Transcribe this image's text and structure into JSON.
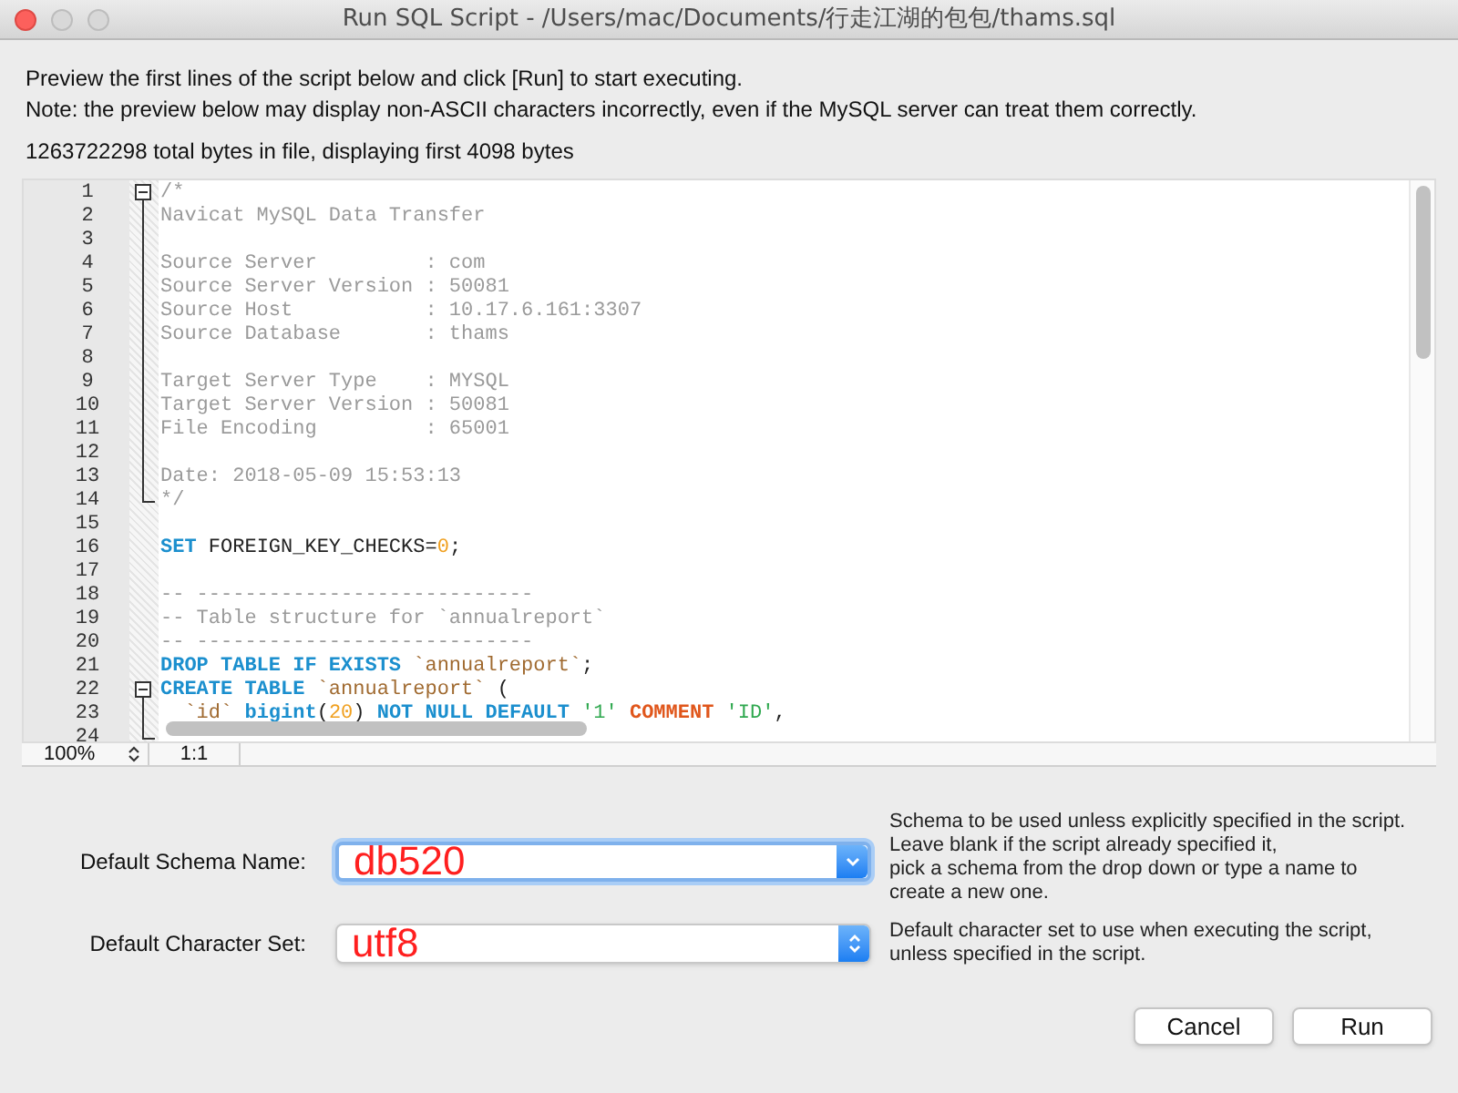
{
  "window": {
    "title": "Run SQL Script - /Users/mac/Documents/行走江湖的包包/thams.sql"
  },
  "intro": [
    "Preview the first lines of the script below and click [Run] to start executing.",
    "Note: the preview below may display non-ASCII characters incorrectly, even if the MySQL server can treat them correctly."
  ],
  "file_info": "1263722298 total bytes in file, displaying first 4098 bytes",
  "editor": {
    "lines": [
      {
        "number": "1",
        "fold_toggle": true,
        "fold_guide": false,
        "fold_end": false,
        "tokens": [
          {
            "kind": "comment",
            "text": "/*"
          }
        ]
      },
      {
        "number": "2",
        "fold_toggle": false,
        "fold_guide": true,
        "fold_end": false,
        "tokens": [
          {
            "kind": "comment",
            "text": "Navicat MySQL Data Transfer"
          }
        ]
      },
      {
        "number": "3",
        "fold_toggle": false,
        "fold_guide": true,
        "fold_end": false
      },
      {
        "number": "4",
        "fold_toggle": false,
        "fold_guide": true,
        "fold_end": false,
        "tokens": [
          {
            "kind": "comment",
            "text": "Source Server         : com"
          }
        ]
      },
      {
        "number": "5",
        "fold_toggle": false,
        "fold_guide": true,
        "fold_end": false,
        "tokens": [
          {
            "kind": "comment",
            "text": "Source Server Version : 50081"
          }
        ]
      },
      {
        "number": "6",
        "fold_toggle": false,
        "fold_guide": true,
        "fold_end": false,
        "tokens": [
          {
            "kind": "comment",
            "text": "Source Host           : 10.17.6.161:3307"
          }
        ]
      },
      {
        "number": "7",
        "fold_toggle": false,
        "fold_guide": true,
        "fold_end": false,
        "tokens": [
          {
            "kind": "comment",
            "text": "Source Database       : thams"
          }
        ]
      },
      {
        "number": "8",
        "fold_toggle": false,
        "fold_guide": true,
        "fold_end": false
      },
      {
        "number": "9",
        "fold_toggle": false,
        "fold_guide": true,
        "fold_end": false,
        "tokens": [
          {
            "kind": "comment",
            "text": "Target Server Type    : MYSQL"
          }
        ]
      },
      {
        "number": "10",
        "fold_toggle": false,
        "fold_guide": true,
        "fold_end": false,
        "tokens": [
          {
            "kind": "comment",
            "text": "Target Server Version : 50081"
          }
        ]
      },
      {
        "number": "11",
        "fold_toggle": false,
        "fold_guide": true,
        "fold_end": false,
        "tokens": [
          {
            "kind": "comment",
            "text": "File Encoding         : 65001"
          }
        ]
      },
      {
        "number": "12",
        "fold_toggle": false,
        "fold_guide": true,
        "fold_end": false
      },
      {
        "number": "13",
        "fold_toggle": false,
        "fold_guide": true,
        "fold_end": false,
        "tokens": [
          {
            "kind": "comment",
            "text": "Date: 2018-05-09 15:53:13"
          }
        ]
      },
      {
        "number": "14",
        "fold_toggle": false,
        "fold_guide": false,
        "fold_end": true,
        "tokens": [
          {
            "kind": "comment",
            "text": "*/"
          }
        ]
      },
      {
        "number": "15",
        "fold_toggle": false,
        "fold_guide": false,
        "fold_end": false
      },
      {
        "number": "16",
        "fold_toggle": false,
        "fold_guide": false,
        "fold_end": false,
        "tokens": [
          {
            "kind": "keyword",
            "text": "SET"
          },
          {
            "kind": "plain",
            "text": " FOREIGN_KEY_CHECKS="
          },
          {
            "kind": "number",
            "text": "0"
          },
          {
            "kind": "plain",
            "text": ";"
          }
        ]
      },
      {
        "number": "17",
        "fold_toggle": false,
        "fold_guide": false,
        "fold_end": false
      },
      {
        "number": "18",
        "fold_toggle": false,
        "fold_guide": false,
        "fold_end": false,
        "tokens": [
          {
            "kind": "comment",
            "text": "-- ----------------------------"
          }
        ]
      },
      {
        "number": "19",
        "fold_toggle": false,
        "fold_guide": false,
        "fold_end": false,
        "tokens": [
          {
            "kind": "comment",
            "text": "-- Table structure for `annualreport`"
          }
        ]
      },
      {
        "number": "20",
        "fold_toggle": false,
        "fold_guide": false,
        "fold_end": false,
        "tokens": [
          {
            "kind": "comment",
            "text": "-- ----------------------------"
          }
        ]
      },
      {
        "number": "21",
        "fold_toggle": false,
        "fold_guide": false,
        "fold_end": false,
        "tokens": [
          {
            "kind": "keyword",
            "text": "DROP TABLE IF EXISTS "
          },
          {
            "kind": "identifier",
            "text": "`annualreport`"
          },
          {
            "kind": "plain",
            "text": ";"
          }
        ]
      },
      {
        "number": "22",
        "fold_toggle": true,
        "fold_guide": false,
        "fold_end": false,
        "tokens": [
          {
            "kind": "keyword",
            "text": "CREATE TABLE "
          },
          {
            "kind": "identifier",
            "text": "`annualreport`"
          },
          {
            "kind": "plain",
            "text": " ("
          }
        ]
      },
      {
        "number": "23",
        "fold_toggle": false,
        "fold_guide": true,
        "fold_end": false,
        "tokens": [
          {
            "kind": "identifier",
            "text": "  `id` "
          },
          {
            "kind": "keyword",
            "text": "bigint"
          },
          {
            "kind": "plain",
            "text": "("
          },
          {
            "kind": "number",
            "text": "20"
          },
          {
            "kind": "plain",
            "text": ") "
          },
          {
            "kind": "keyword",
            "text": "NOT NULL DEFAULT "
          },
          {
            "kind": "string",
            "text": "'1' "
          },
          {
            "kind": "attribute",
            "text": "COMMENT "
          },
          {
            "kind": "string",
            "text": "'ID'"
          },
          {
            "kind": "plain",
            "text": ","
          }
        ]
      },
      {
        "number": "24",
        "fold_toggle": false,
        "fold_guide": false,
        "fold_end": true
      }
    ],
    "zoom": "100%",
    "position": "1:1"
  },
  "fields": [
    {
      "label": "Default Schema Name:",
      "value": "db520",
      "kind": "combobox",
      "focused": true,
      "help": "Schema to be used unless explicitly specified in the script.\nLeave blank if the script already specified it,\npick a schema from the drop down or type a name to\ncreate a new one."
    },
    {
      "label": "Default Character Set:",
      "value": "utf8",
      "kind": "popup",
      "focused": false,
      "help": "Default character set to use when executing the script,\nunless specified in the script."
    }
  ],
  "buttons": [
    "Cancel",
    "Run"
  ]
}
